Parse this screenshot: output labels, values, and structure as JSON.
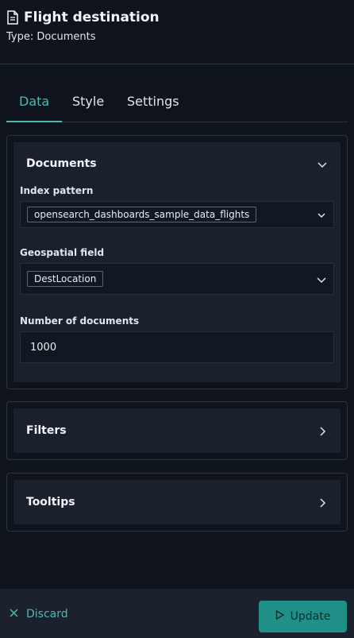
{
  "header": {
    "title": "Flight destination",
    "subtitle": "Type: Documents"
  },
  "tabs": [
    {
      "label": "Data",
      "active": true
    },
    {
      "label": "Style",
      "active": false
    },
    {
      "label": "Settings",
      "active": false
    }
  ],
  "documents_panel": {
    "title": "Documents",
    "expanded": true,
    "index_pattern": {
      "label": "Index pattern",
      "value": "opensearch_dashboards_sample_data_flights"
    },
    "geospatial_field": {
      "label": "Geospatial field",
      "value": "DestLocation"
    },
    "number_of_documents": {
      "label": "Number of documents",
      "value": "1000"
    }
  },
  "filters_panel": {
    "title": "Filters",
    "expanded": false
  },
  "tooltips_panel": {
    "title": "Tooltips",
    "expanded": false
  },
  "footer": {
    "discard_label": "Discard",
    "update_label": "Update"
  },
  "colors": {
    "accent": "#4fb8b0",
    "primary_button": "#1f8f87",
    "background": "#0f141c",
    "panel": "#1a212c"
  }
}
